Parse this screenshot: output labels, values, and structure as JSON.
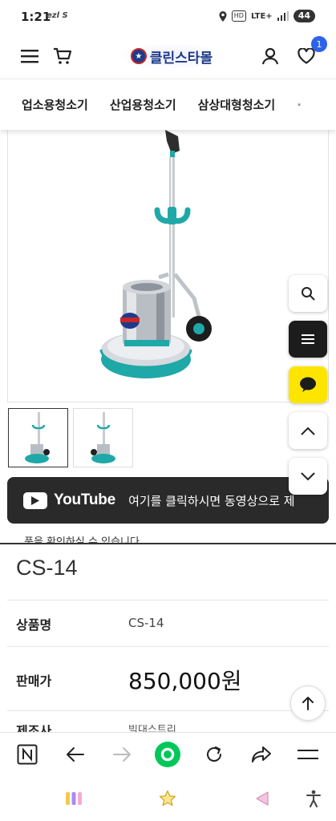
{
  "status_bar": {
    "time": "1:21",
    "carrier_icons": "ezl S",
    "network": "LTE+",
    "hd": "HD",
    "battery": "44"
  },
  "header": {
    "logo_text": "클린스타몰",
    "wishlist_count": "1"
  },
  "categories": [
    "업소용청소기",
    "산업용청소기",
    "삼상대형청소기"
  ],
  "youtube_banner": {
    "brand": "YouTube",
    "message": "여기를 클릭하시면 동영상으로 제"
  },
  "partial_text": "품을 확인하실 수 있습니다",
  "product": {
    "title": "CS-14",
    "name_label": "상품명",
    "name_value": "CS-14",
    "price_label": "판매가",
    "price_value": "850,000원",
    "next_label": "제조사",
    "next_value": "빅대스트리"
  },
  "icons": {
    "menu": "menu-icon",
    "cart": "cart-icon",
    "user": "user-icon",
    "heart": "heart-icon",
    "search": "search-icon",
    "list": "list-icon",
    "chat": "chat-icon",
    "up": "chevron-up-icon",
    "down": "chevron-down-icon"
  },
  "colors": {
    "accent_blue": "#2d63e8",
    "logo_navy": "#1e3a8a",
    "kakao_yellow": "#fee500",
    "naver_green": "#03c75a",
    "teal": "#1ab0b0"
  }
}
